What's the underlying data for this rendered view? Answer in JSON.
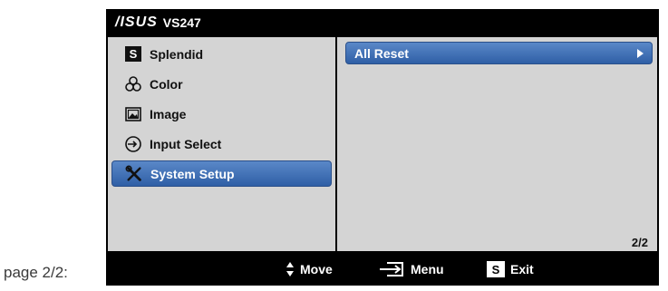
{
  "caption": "page 2/2:",
  "header": {
    "brand": "/ISUS",
    "model": "VS247"
  },
  "menu": {
    "items": [
      {
        "label": "Splendid",
        "icon": "splendid-s-icon",
        "badge": "S"
      },
      {
        "label": "Color",
        "icon": "color-icon"
      },
      {
        "label": "Image",
        "icon": "image-icon"
      },
      {
        "label": "Input Select",
        "icon": "input-select-icon"
      },
      {
        "label": "System Setup",
        "icon": "wrench-screwdriver-icon",
        "selected": true
      }
    ]
  },
  "submenu": {
    "item": "All Reset",
    "icon": "arrow-right-icon"
  },
  "page_indicator": "2/2",
  "footer": {
    "move": "Move",
    "move_icon": "up-down-arrows-icon",
    "menu": "Menu",
    "menu_icon": "enter-icon",
    "exit": "Exit",
    "exit_icon": "splendid-s-icon",
    "exit_badge": "S"
  },
  "colors": {
    "osd_bg": "#000000",
    "panel_bg": "#d4d4d4",
    "highlight_top": "#5a88c8",
    "highlight_bottom": "#2f5fa6"
  }
}
